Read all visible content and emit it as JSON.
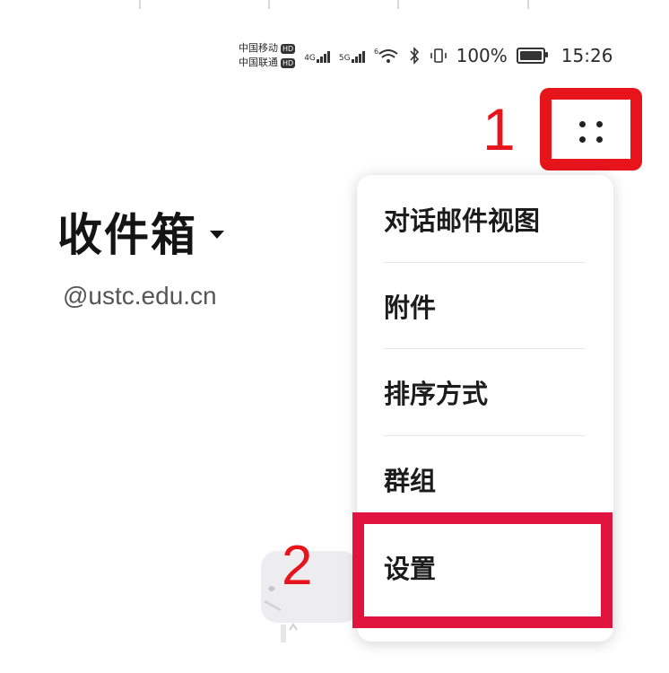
{
  "status_bar": {
    "carrier_1": "中国移动",
    "carrier_2": "中国联通",
    "hd_badge": "HD",
    "net_1": "4G",
    "net_2": "5G",
    "wifi_label": "6",
    "battery_text": "100%",
    "time": "15:26"
  },
  "header": {
    "title": "收件箱",
    "account": "@ustc.edu.cn"
  },
  "menu": {
    "items": [
      {
        "label": "对话邮件视图"
      },
      {
        "label": "附件"
      },
      {
        "label": "排序方式"
      },
      {
        "label": "群组"
      },
      {
        "label": "设置"
      }
    ]
  },
  "annotations": {
    "step_1": "1",
    "step_2": "2"
  },
  "colors": {
    "highlight": "#e8141c",
    "text_primary": "#1c1c1c",
    "text_secondary": "#555555"
  },
  "icons": {
    "more_button": "more-dots-icon",
    "title_caret": "caret-down-icon"
  }
}
